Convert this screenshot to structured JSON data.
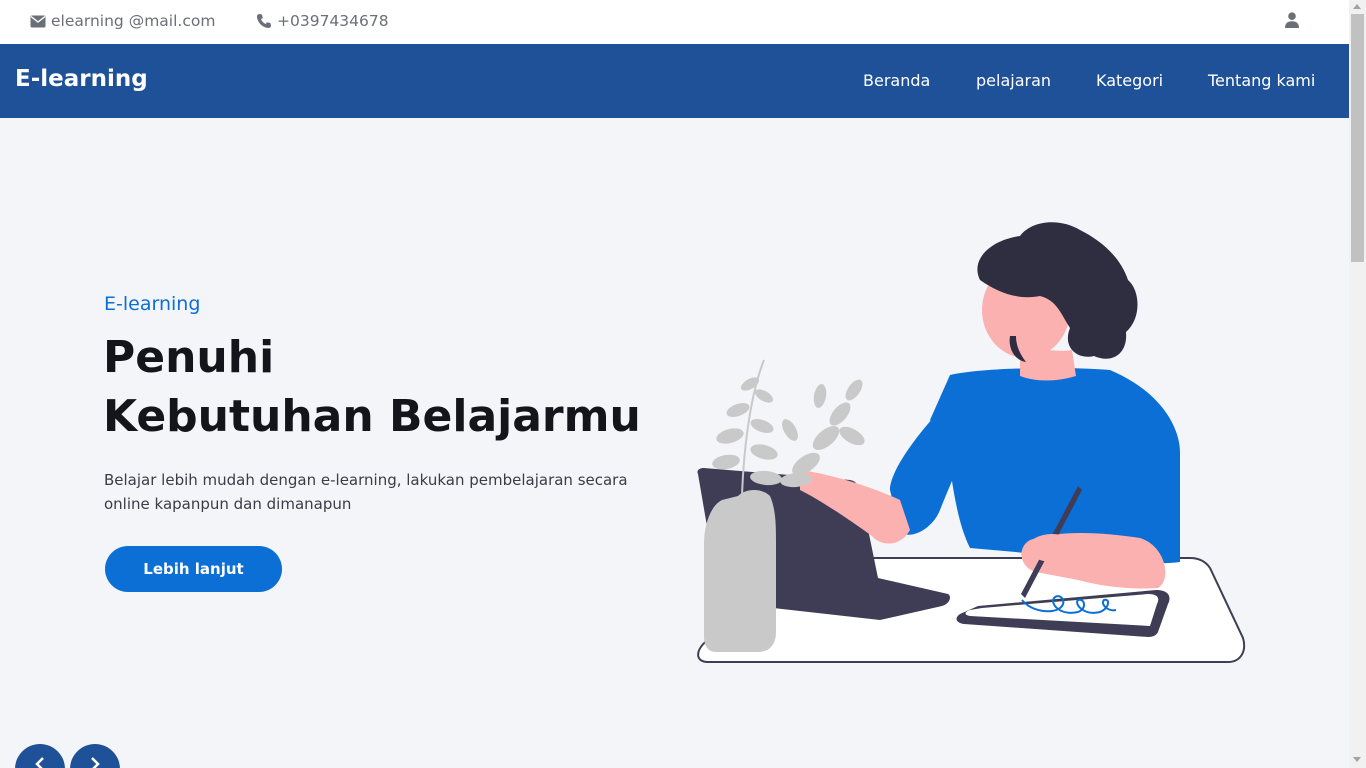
{
  "topbar": {
    "email": {
      "icon": "envelope-icon",
      "text": "elearning @mail.com"
    },
    "phone": {
      "icon": "phone-icon",
      "text": "+0397434678"
    },
    "user_icon": "user-icon"
  },
  "navbar": {
    "brand": "E-learning",
    "links": [
      {
        "label": "Beranda"
      },
      {
        "label": "pelajaran"
      },
      {
        "label": "Kategori"
      },
      {
        "label": "Tentang kami"
      }
    ]
  },
  "hero": {
    "tag": "E-learning",
    "title_line1": "Penuhi",
    "title_line2": "Kebutuhan Belajarmu",
    "description": "Belajar lebih mudah dengan e-learning, lakukan pembelajaran secara online kapanpun dan dimanapun",
    "button_label": "Lebih lanjut",
    "illustration": "person-studying-with-laptop-and-tablet-illustration"
  },
  "slider": {
    "prev_icon": "chevron-left-icon",
    "next_icon": "chevron-right-icon"
  },
  "colors": {
    "navbar": "#1f5198",
    "accent": "#0b6fd6",
    "page_background": "#f4f5f9"
  }
}
